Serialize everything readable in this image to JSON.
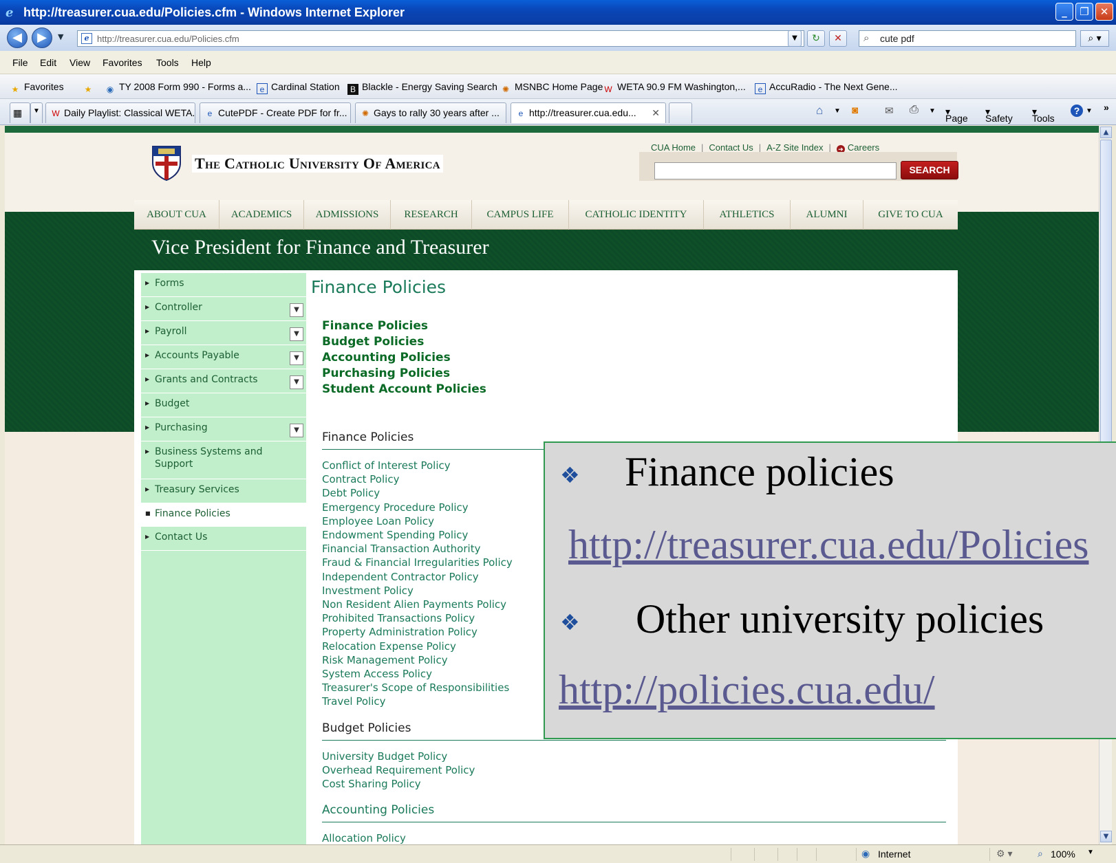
{
  "window": {
    "title": "http://treasurer.cua.edu/Policies.cfm - Windows Internet Explorer",
    "minimize": "_",
    "restore": "❐",
    "close": "✕"
  },
  "address_bar": {
    "url": "http://treasurer.cua.edu/Policies.cfm",
    "search_value": "cute pdf"
  },
  "menu": [
    "File",
    "Edit",
    "View",
    "Favorites",
    "Tools",
    "Help"
  ],
  "favorites_bar": {
    "label": "Favorites",
    "items": [
      "TY 2008 Form 990 - Forms a...",
      "Cardinal Station",
      "Blackle - Energy Saving Search",
      "MSNBC Home Page",
      "WETA 90.9 FM Washington,...",
      "AccuRadio - The Next Gene..."
    ]
  },
  "tabs": [
    "Daily Playlist: Classical WETA...",
    "CutePDF - Create PDF for fr...",
    "Gays to rally 30 years after ...",
    "http://treasurer.cua.edu..."
  ],
  "command_bar": [
    "Page",
    "Safety",
    "Tools"
  ],
  "site": {
    "university_name": "The Catholic University Of America",
    "top_links": [
      "CUA Home",
      "Contact Us",
      "A-Z Site Index",
      "Careers"
    ],
    "search_button": "SEARCH",
    "nav": [
      "ABOUT CUA",
      "ACADEMICS",
      "ADMISSIONS",
      "RESEARCH",
      "CAMPUS LIFE",
      "CATHOLIC IDENTITY",
      "ATHLETICS",
      "ALUMNI",
      "GIVE TO CUA"
    ],
    "section_title": "Vice President for Finance and Treasurer"
  },
  "left_nav": [
    {
      "label": "Forms",
      "dropdown": false
    },
    {
      "label": "Controller",
      "dropdown": true
    },
    {
      "label": "Payroll",
      "dropdown": true
    },
    {
      "label": "Accounts Payable",
      "dropdown": true
    },
    {
      "label": "Grants and Contracts",
      "dropdown": true
    },
    {
      "label": "Budget",
      "dropdown": false
    },
    {
      "label": "Purchasing",
      "dropdown": true
    },
    {
      "label": "Business Systems and Support",
      "dropdown": false
    },
    {
      "label": "Treasury Services",
      "dropdown": false
    },
    {
      "label": "Finance Policies",
      "dropdown": false,
      "active": true
    },
    {
      "label": "Contact Us",
      "dropdown": false
    }
  ],
  "main": {
    "heading": "Finance Policies",
    "quick_links": [
      "Finance Policies",
      "Budget Policies",
      "Accounting Policies",
      "Purchasing Policies",
      "Student Account Policies"
    ],
    "finance_heading": "Finance Policies",
    "finance_links": [
      "Conflict of Interest Policy",
      "Contract Policy",
      "Debt Policy",
      "Emergency Procedure Policy",
      "Employee Loan Policy",
      "Endowment Spending Policy",
      "Financial Transaction Authority",
      "Fraud & Financial Irregularities Policy",
      "Independent Contractor Policy",
      "Investment Policy",
      "Non Resident Alien Payments Policy",
      "Prohibited Transactions Policy",
      "Property Administration Policy",
      "Relocation Expense Policy",
      "Risk Management Policy",
      "System Access Policy",
      "Treasurer's Scope of Responsibilities",
      "Travel Policy"
    ],
    "budget_heading": "Budget Policies",
    "budget_links": [
      "University Budget Policy",
      "Overhead Requirement Policy",
      "Cost Sharing Policy"
    ],
    "accounting_heading": "Accounting Policies",
    "accounting_links": [
      "Allocation Policy"
    ]
  },
  "callout": {
    "item1": "Finance policies",
    "link1": "http://treasurer.cua.edu/Policies",
    "item2": "Other university policies",
    "link2": "http://policies.cua.edu/"
  },
  "status_bar": {
    "zone": "Internet",
    "zoom": "100%"
  },
  "colors": {
    "site_green": "#1c5f33",
    "left_nav_bg": "#c1efcb",
    "search_button": "#a81616",
    "callout_bg": "#d8d8d8"
  }
}
